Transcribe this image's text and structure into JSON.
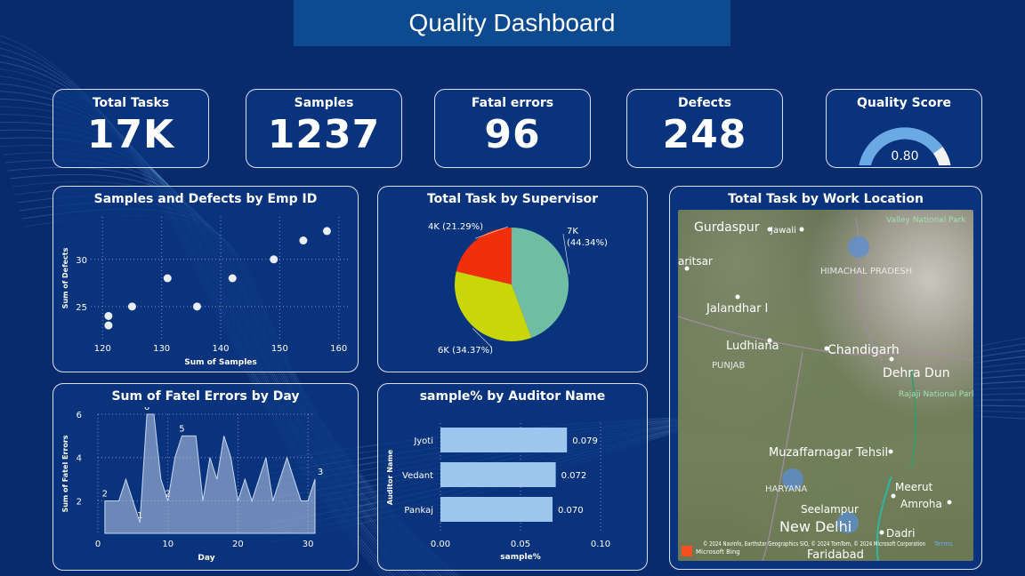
{
  "header": {
    "title": "Quality Dashboard"
  },
  "kpis": [
    {
      "label": "Total Tasks",
      "value": "17K"
    },
    {
      "label": "Samples",
      "value": "1237"
    },
    {
      "label": "Fatal errors",
      "value": "96"
    },
    {
      "label": "Defects",
      "value": "248"
    }
  ],
  "quality_score": {
    "label": "Quality Score",
    "value": "0.80",
    "fraction": 0.8
  },
  "panels": {
    "scatter": "Samples and Defects by Emp ID",
    "pie": "Total Task by Supervisor",
    "map": "Total Task by Work Location",
    "area": "Sum of Fatel Errors by Day",
    "bar": "sample% by Auditor Name"
  },
  "map": {
    "labels": [
      "Gurdaspur",
      "Jawali",
      "Valley National Park",
      "HIMACHAL PRADESH",
      "aritsar",
      "Jalandhar I",
      "Ludhiana",
      "Chandigarh",
      "PUNJAB",
      "Dehra Dun",
      "Rajaji National Park",
      "Muzaffarnagar Tehsil",
      "HARYANA",
      "Meerut",
      "Seelampur",
      "Amroha",
      "New Delhi",
      "Dadri",
      "Faridabad"
    ],
    "attribution": "© 2024 NavInfo, Earthstar Geographics SIO, © 2024 TomTom, © 2024 Microsoft Corporation",
    "bing": "Microsoft Bing",
    "terms": "Terms"
  },
  "chart_data": [
    {
      "type": "scatter",
      "title": "Samples and Defects by Emp ID",
      "xlabel": "Sum of Samples",
      "ylabel": "Sum of Defects",
      "xlim": [
        118,
        162
      ],
      "ylim": [
        21.5,
        34.5
      ],
      "xticks": [
        120,
        130,
        140,
        150,
        160
      ],
      "yticks": [
        25,
        30
      ],
      "points": [
        [
          121,
          24
        ],
        [
          121,
          23
        ],
        [
          125,
          25
        ],
        [
          131,
          28
        ],
        [
          136,
          25
        ],
        [
          142,
          28
        ],
        [
          149,
          30
        ],
        [
          154,
          32
        ],
        [
          158,
          33
        ]
      ]
    },
    {
      "type": "pie",
      "title": "Total Task by Supervisor",
      "slices": [
        {
          "label": "7K",
          "pct": "(44.34%)",
          "value": 44.34,
          "color": "#6fbea3"
        },
        {
          "label": "6K (34.37%)",
          "value": 34.37,
          "color": "#c9d60a"
        },
        {
          "label": "4K (21.29%)",
          "value": 21.29,
          "color": "#f0300a"
        }
      ]
    },
    {
      "type": "area",
      "title": "Sum of Fatel Errors by Day",
      "xlabel": "Day",
      "ylabel": "Sum of Fatel Errors",
      "xlim": [
        0,
        31
      ],
      "ylim": [
        0.5,
        6
      ],
      "xticks": [
        0,
        10,
        20,
        30
      ],
      "yticks": [
        2,
        4,
        6
      ],
      "x": [
        1,
        2,
        3,
        4,
        5,
        6,
        7,
        8,
        9,
        10,
        11,
        12,
        13,
        14,
        15,
        16,
        17,
        18,
        19,
        20,
        21,
        22,
        23,
        24,
        25,
        26,
        27,
        28,
        29,
        30,
        31
      ],
      "values": [
        2,
        2,
        2,
        3,
        2,
        1,
        6,
        6,
        3,
        2,
        4,
        5,
        5,
        5,
        2,
        4,
        3,
        5,
        4,
        2,
        3,
        2,
        3,
        4,
        2,
        3,
        4,
        3,
        2,
        2,
        3
      ],
      "labels": [
        {
          "x": 1,
          "text": "2"
        },
        {
          "x": 6,
          "text": "1"
        },
        {
          "x": 7,
          "text": "6"
        },
        {
          "x": 10,
          "text": "2"
        },
        {
          "x": 12,
          "text": "5"
        },
        {
          "x": 31,
          "text": "3"
        }
      ]
    },
    {
      "type": "bar",
      "title": "sample% by Auditor Name",
      "xlabel": "sample%",
      "ylabel": "Auditor Name",
      "categories": [
        "Jyoti",
        "Vedant",
        "Pankaj"
      ],
      "values": [
        0.079,
        0.072,
        0.07
      ],
      "value_labels": [
        "0.079",
        "0.072",
        "0.070"
      ],
      "xlim": [
        0,
        0.1
      ],
      "xticks": [
        "0.00",
        "0.05",
        "0.10"
      ],
      "color": "#9dc6ee"
    }
  ]
}
